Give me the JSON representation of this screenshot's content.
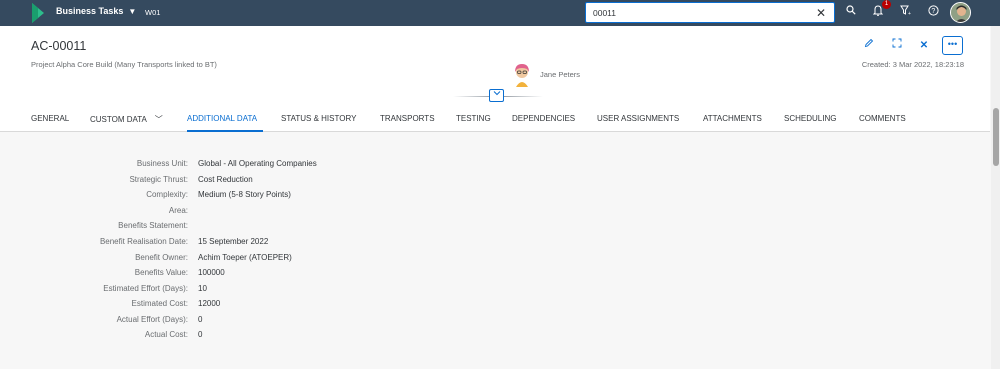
{
  "shell": {
    "app_title": "Business Tasks",
    "system_id": "W01",
    "search_value": "00011",
    "notification_count": "1"
  },
  "header": {
    "object_id": "AC-00011",
    "subtitle": "Project Alpha Core Build (Many Transports linked to BT)",
    "created": "Created: 3 Mar 2022, 18:23:18",
    "person_name": "Jane Peters"
  },
  "tabs": [
    {
      "label": "GENERAL"
    },
    {
      "label": "CUSTOM DATA"
    },
    {
      "label": "ADDITIONAL DATA"
    },
    {
      "label": "STATUS & HISTORY"
    },
    {
      "label": "TRANSPORTS"
    },
    {
      "label": "TESTING"
    },
    {
      "label": "DEPENDENCIES"
    },
    {
      "label": "USER ASSIGNMENTS"
    },
    {
      "label": "ATTACHMENTS"
    },
    {
      "label": "SCHEDULING"
    },
    {
      "label": "COMMENTS"
    }
  ],
  "fields": [
    {
      "label": "Business Unit:",
      "value": "Global - All Operating Companies"
    },
    {
      "label": "Strategic Thrust:",
      "value": "Cost Reduction"
    },
    {
      "label": "Complexity:",
      "value": "Medium (5-8 Story Points)"
    },
    {
      "label": "Area:",
      "value": ""
    },
    {
      "label": "Benefits Statement:",
      "value": ""
    },
    {
      "label": "Benefit Realisation Date:",
      "value": "15 September 2022"
    },
    {
      "label": "Benefit Owner:",
      "value": "Achim Toeper (ATOEPER)"
    },
    {
      "label": "Benefits Value:",
      "value": "100000"
    },
    {
      "label": "Estimated Effort (Days):",
      "value": "10"
    },
    {
      "label": "Estimated Cost:",
      "value": "12000"
    },
    {
      "label": "Actual Effort (Days):",
      "value": "0"
    },
    {
      "label": "Actual Cost:",
      "value": "0"
    }
  ],
  "colors": {
    "shell_bg": "#354a5f",
    "accent": "#0a6ed1",
    "badge": "#bb0000"
  }
}
